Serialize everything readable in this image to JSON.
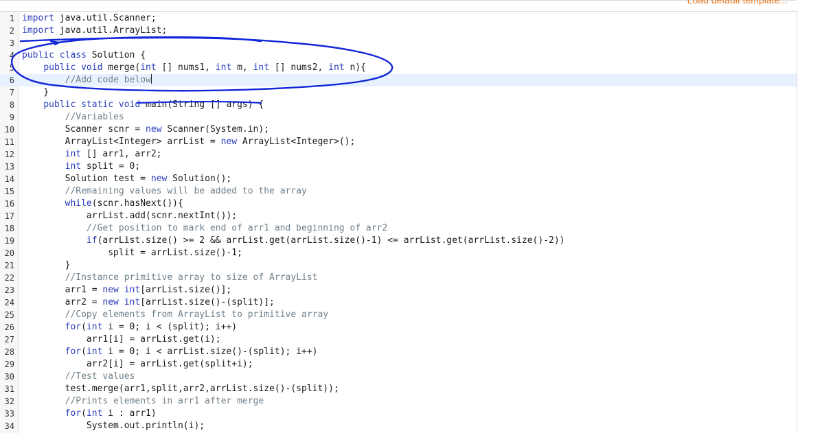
{
  "header": {
    "link_label": "Load default template..."
  },
  "editor": {
    "lines": [
      "import java.util.Scanner;",
      "import java.util.ArrayList;",
      "",
      "public class Solution {",
      "    public void merge(int [] nums1, int m, int [] nums2, int n){",
      "        //Add code below",
      "    }",
      "    public static void main(String [] args) {",
      "        //Variables",
      "        Scanner scnr = new Scanner(System.in);",
      "        ArrayList<Integer> arrList = new ArrayList<Integer>();",
      "        int [] arr1, arr2;",
      "        int split = 0;",
      "        Solution test = new Solution();",
      "        //Remaining values will be added to the array",
      "        while(scnr.hasNext()){",
      "            arrList.add(scnr.nextInt());",
      "            //Get position to mark end of arr1 and beginning of arr2",
      "            if(arrList.size() >= 2 && arrList.get(arrList.size()-1) <= arrList.get(arrList.size()-2))",
      "                split = arrList.size()-1;",
      "        }",
      "        //Instance primitive array to size of ArrayList",
      "        arr1 = new int[arrList.size()];",
      "        arr2 = new int[arrList.size()-(split)];",
      "        //Copy elements from ArrayList to primitive array",
      "        for(int i = 0; i < (split); i++)",
      "            arr1[i] = arrList.get(i);",
      "        for(int i = 0; i < arrList.size()-(split); i++)",
      "            arr2[i] = arrList.get(split+i);",
      "        //Test values",
      "        test.merge(arr1,split,arr2,arrList.size()-(split));",
      "        //Prints elements in arr1 after merge",
      "        for(int i : arr1)",
      "            System.out.println(i);"
    ],
    "active_line": 6,
    "colors": {
      "keyword": "#2a3dbf",
      "comment": "#6f7f8a",
      "annotation_ink": "#1226d9",
      "link": "#e8771e"
    }
  }
}
